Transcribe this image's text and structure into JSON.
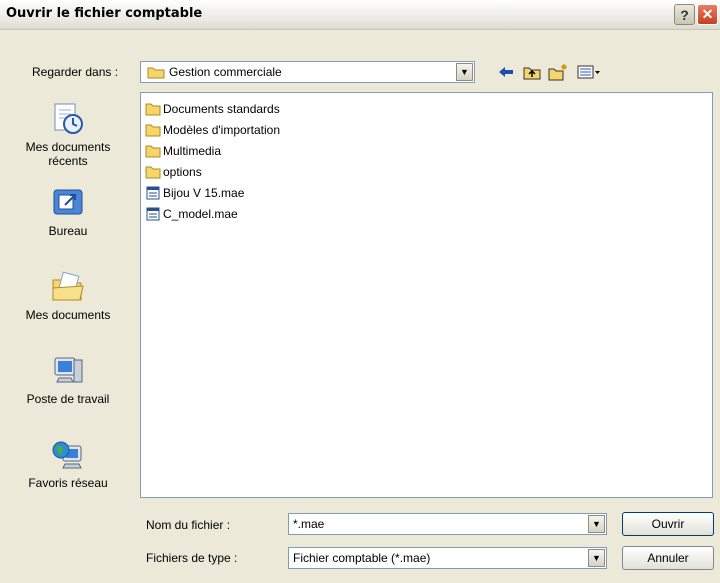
{
  "window": {
    "title": "Ouvrir le fichier comptable"
  },
  "titlebar_buttons": {
    "help": "?",
    "close": "✕"
  },
  "look_in": {
    "label": "Regarder dans :",
    "value": "Gestion commerciale"
  },
  "places": [
    {
      "label": "Mes documents récents",
      "icon": "recent-documents-icon"
    },
    {
      "label": "Bureau",
      "icon": "desktop-icon"
    },
    {
      "label": "Mes documents",
      "icon": "my-documents-icon"
    },
    {
      "label": "Poste de travail",
      "icon": "my-computer-icon"
    },
    {
      "label": "Favoris réseau",
      "icon": "network-places-icon"
    }
  ],
  "files": [
    {
      "name": "Documents standards",
      "type": "folder"
    },
    {
      "name": "Modèles d'importation",
      "type": "folder"
    },
    {
      "name": "Multimedia",
      "type": "folder"
    },
    {
      "name": "options",
      "type": "folder"
    },
    {
      "name": "Bijou V 15.mae",
      "type": "file"
    },
    {
      "name": "C_model.mae",
      "type": "file"
    }
  ],
  "filename": {
    "label": "Nom du fichier :",
    "value": "*.mae"
  },
  "filetype": {
    "label": "Fichiers de type :",
    "value": "Fichier comptable (*.mae)"
  },
  "buttons": {
    "open": "Ouvrir",
    "cancel": "Annuler"
  },
  "colors": {
    "folder": "#f5d66b",
    "window_bg": "#ece9d8",
    "close": "#d2542f"
  }
}
